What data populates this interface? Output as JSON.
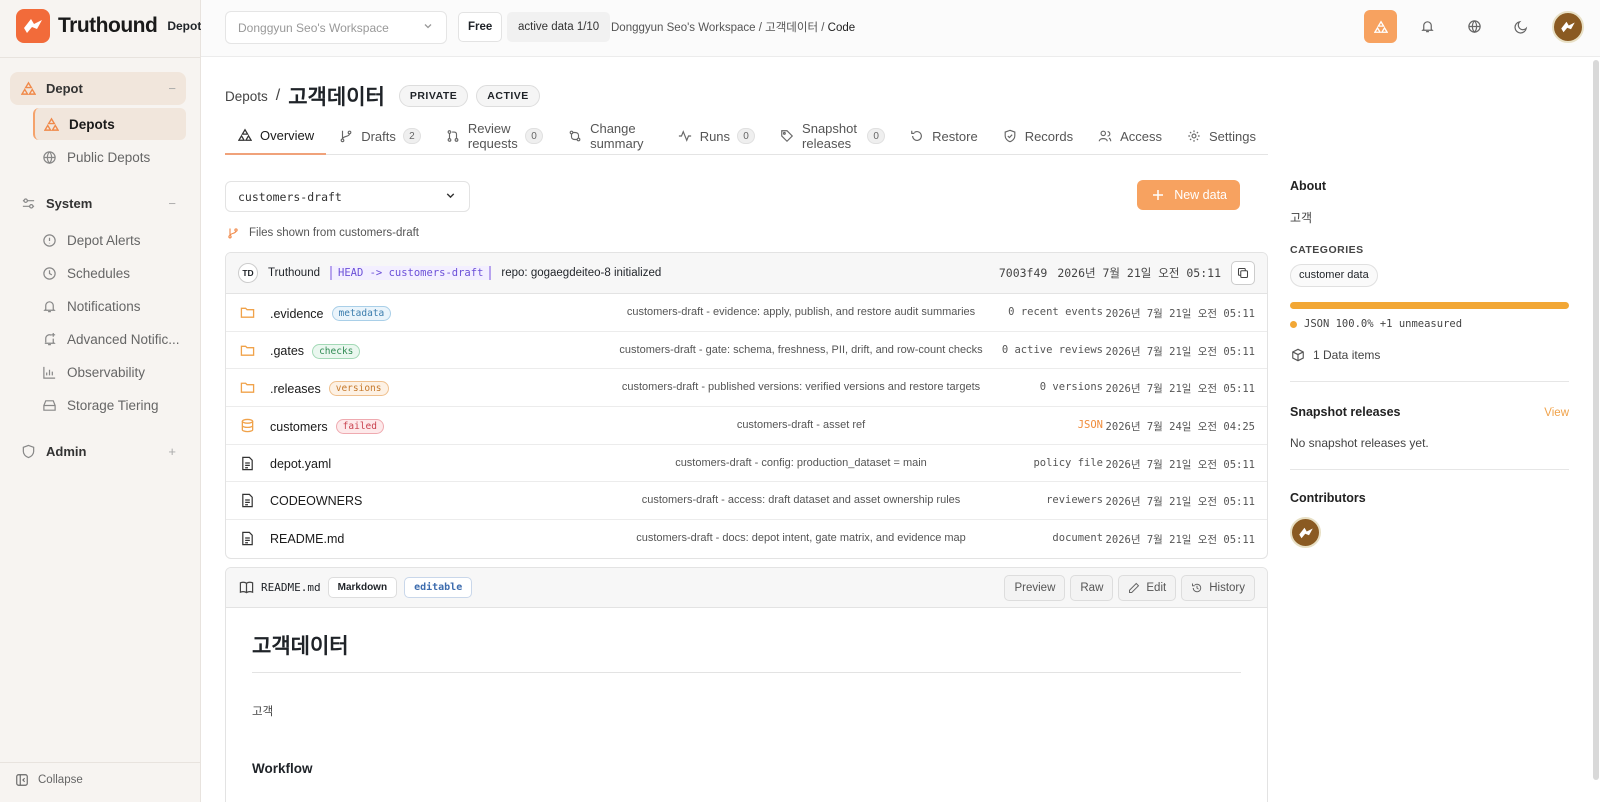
{
  "brand": {
    "name": "Truthound",
    "sub": "Depot",
    "accent": "#f26b3a",
    "accent_light": "#f7a260"
  },
  "sidebar": {
    "sections": [
      {
        "label": "Depot",
        "toggle": "−",
        "items": [
          {
            "label": "Depots",
            "icon": "depot-icon",
            "active": true
          },
          {
            "label": "Public Depots",
            "icon": "globe-icon"
          }
        ]
      },
      {
        "label": "System",
        "toggle": "−",
        "items": [
          {
            "label": "Depot Alerts",
            "icon": "alert-icon"
          },
          {
            "label": "Schedules",
            "icon": "clock-icon"
          },
          {
            "label": "Notifications",
            "icon": "bell-icon"
          },
          {
            "label": "Advanced Notific...",
            "icon": "bell-plus-icon"
          },
          {
            "label": "Observability",
            "icon": "chart-icon"
          },
          {
            "label": "Storage Tiering",
            "icon": "storage-icon"
          }
        ]
      },
      {
        "label": "Admin",
        "toggle": "+",
        "items": []
      }
    ],
    "collapse_label": "Collapse"
  },
  "topbar": {
    "workspace_placeholder": "Donggyun Seo's Workspace",
    "plan": "Free",
    "active_data": "active data 1/10",
    "breadcrumb": [
      "Donggyun Seo's Workspace",
      "고객데이터",
      "Code"
    ]
  },
  "page": {
    "crumb": "Depots",
    "title": "고객데이터",
    "visibility": "PRIVATE",
    "status": "ACTIVE",
    "tabs": [
      {
        "label": "Overview",
        "icon": "overview-icon",
        "active": true
      },
      {
        "label": "Drafts",
        "icon": "branch-icon",
        "count": "2"
      },
      {
        "label": "Review requests",
        "icon": "pull-request-icon",
        "count": "0"
      },
      {
        "label": "Change summary",
        "icon": "diff-icon"
      },
      {
        "label": "Runs",
        "icon": "activity-icon",
        "count": "0"
      },
      {
        "label": "Snapshot releases",
        "icon": "tag-icon",
        "count": "0"
      },
      {
        "label": "Restore",
        "icon": "restore-icon"
      },
      {
        "label": "Records",
        "icon": "shield-icon"
      },
      {
        "label": "Access",
        "icon": "users-icon"
      },
      {
        "label": "Settings",
        "icon": "gear-icon"
      }
    ],
    "branch": "customers-draft",
    "new_data": "New data",
    "files_from": "Files shown from customers-draft"
  },
  "commit": {
    "avatar": "TD",
    "author": "Truthound",
    "ref": "HEAD -> customers-draft",
    "message": "repo: gogaegdeiteo-8 initialized",
    "hash": "7003f49",
    "date": "2026년 7월 21일 오전 05:11"
  },
  "files": [
    {
      "name": ".evidence",
      "type": "folder",
      "tag": "metadata",
      "tag_color": "blue",
      "message": "customers-draft - evidence: apply, publish, and restore audit summaries",
      "meta": "0 recent events",
      "date": "2026년 7월 21일 오전 05:11"
    },
    {
      "name": ".gates",
      "type": "folder",
      "tag": "checks",
      "tag_color": "green",
      "message": "customers-draft - gate: schema, freshness, PII, drift, and row-count checks",
      "meta": "0 active reviews",
      "date": "2026년 7월 21일 오전 05:11"
    },
    {
      "name": ".releases",
      "type": "folder",
      "tag": "versions",
      "tag_color": "orange",
      "message": "customers-draft - published versions: verified versions and restore targets",
      "meta": "0 versions",
      "date": "2026년 7월 21일 오전 05:11"
    },
    {
      "name": "customers",
      "type": "database",
      "tag": "failed",
      "tag_color": "red",
      "message": "customers-draft - asset ref",
      "meta": "JSON",
      "date": "2026년 7월 24일 오전 04:25"
    },
    {
      "name": "depot.yaml",
      "type": "file",
      "tag": "",
      "message": "customers-draft - config: production_dataset = main",
      "meta": "policy file",
      "date": "2026년 7월 21일 오전 05:11"
    },
    {
      "name": "CODEOWNERS",
      "type": "file",
      "tag": "",
      "message": "customers-draft - access: draft dataset and asset ownership rules",
      "meta": "reviewers",
      "date": "2026년 7월 21일 오전 05:11"
    },
    {
      "name": "README.md",
      "type": "file",
      "tag": "",
      "message": "customers-draft - docs: depot intent, gate matrix, and evidence map",
      "meta": "document",
      "date": "2026년 7월 21일 오전 05:11"
    }
  ],
  "readme": {
    "filename": "README.md",
    "format": "Markdown",
    "mode": "editable",
    "buttons": [
      "Preview",
      "Raw",
      "Edit",
      "History"
    ],
    "heading": "고객데이터",
    "body": "고객",
    "section": "Workflow"
  },
  "about": {
    "heading": "About",
    "description": "고객",
    "categories_label": "CATEGORIES",
    "category": "customer data",
    "language": "JSON 100.0% +1 unmeasured",
    "language_share": 1.0,
    "items": "1 Data items",
    "snapshot_heading": "Snapshot releases",
    "snapshot_link": "View",
    "snapshot_empty": "No snapshot releases yet.",
    "contributors_heading": "Contributors"
  }
}
